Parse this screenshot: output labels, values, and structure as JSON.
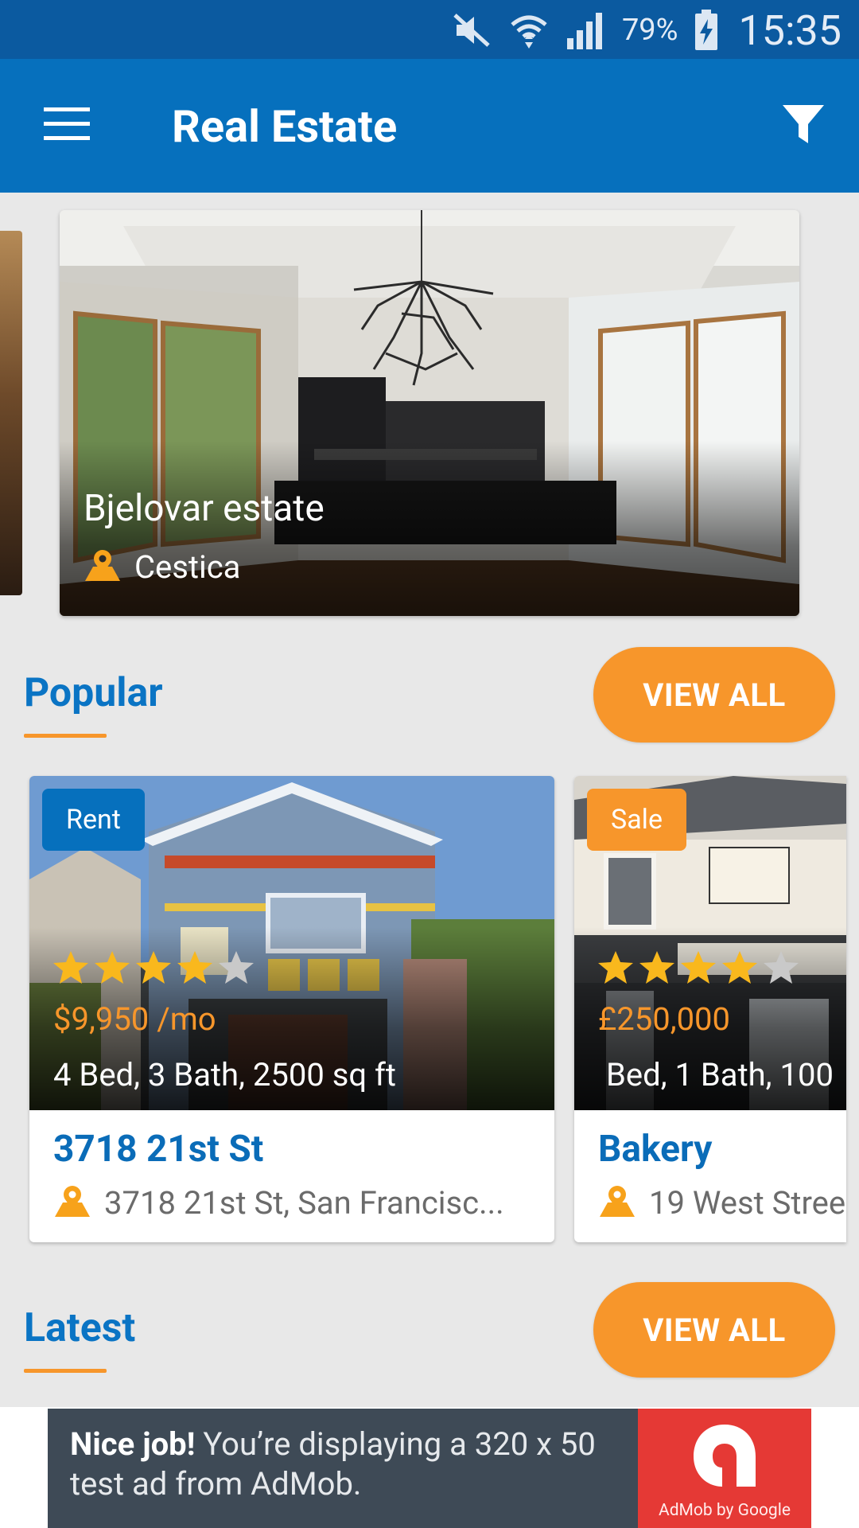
{
  "status_bar": {
    "battery": "79%",
    "time": "15:35"
  },
  "app_bar": {
    "title": "Real Estate"
  },
  "featured": {
    "title": "Bjelovar estate",
    "location": "Cestica"
  },
  "popular": {
    "heading": "Popular",
    "view_all": "VIEW ALL",
    "cards": [
      {
        "badge": "Rent",
        "badge_color": "#0670bd",
        "rating": 4,
        "price": "$9,950 /mo",
        "features": "4 Bed, 3 Bath, 2500 sq ft",
        "name": "3718 21st St",
        "address": "3718 21st St, San Francisc..."
      },
      {
        "badge": "Sale",
        "badge_color": "#f7962b",
        "rating": 4,
        "price": "£250,000",
        "features": "Bed, 1 Bath, 100",
        "name": "Bakery",
        "address": "19 West Stree"
      }
    ]
  },
  "latest": {
    "heading": "Latest",
    "view_all": "VIEW ALL"
  },
  "ad": {
    "headline": "Nice job!",
    "body": "You’re displaying a 320 x 50 test ad from AdMob.",
    "logo_text": "AdMob by Google"
  },
  "colors": {
    "primary": "#0670bd",
    "status_bar": "#0b5aa0",
    "accent": "#f7962b",
    "star_filled": "#f9b81d",
    "star_empty": "#c9c9c9"
  }
}
